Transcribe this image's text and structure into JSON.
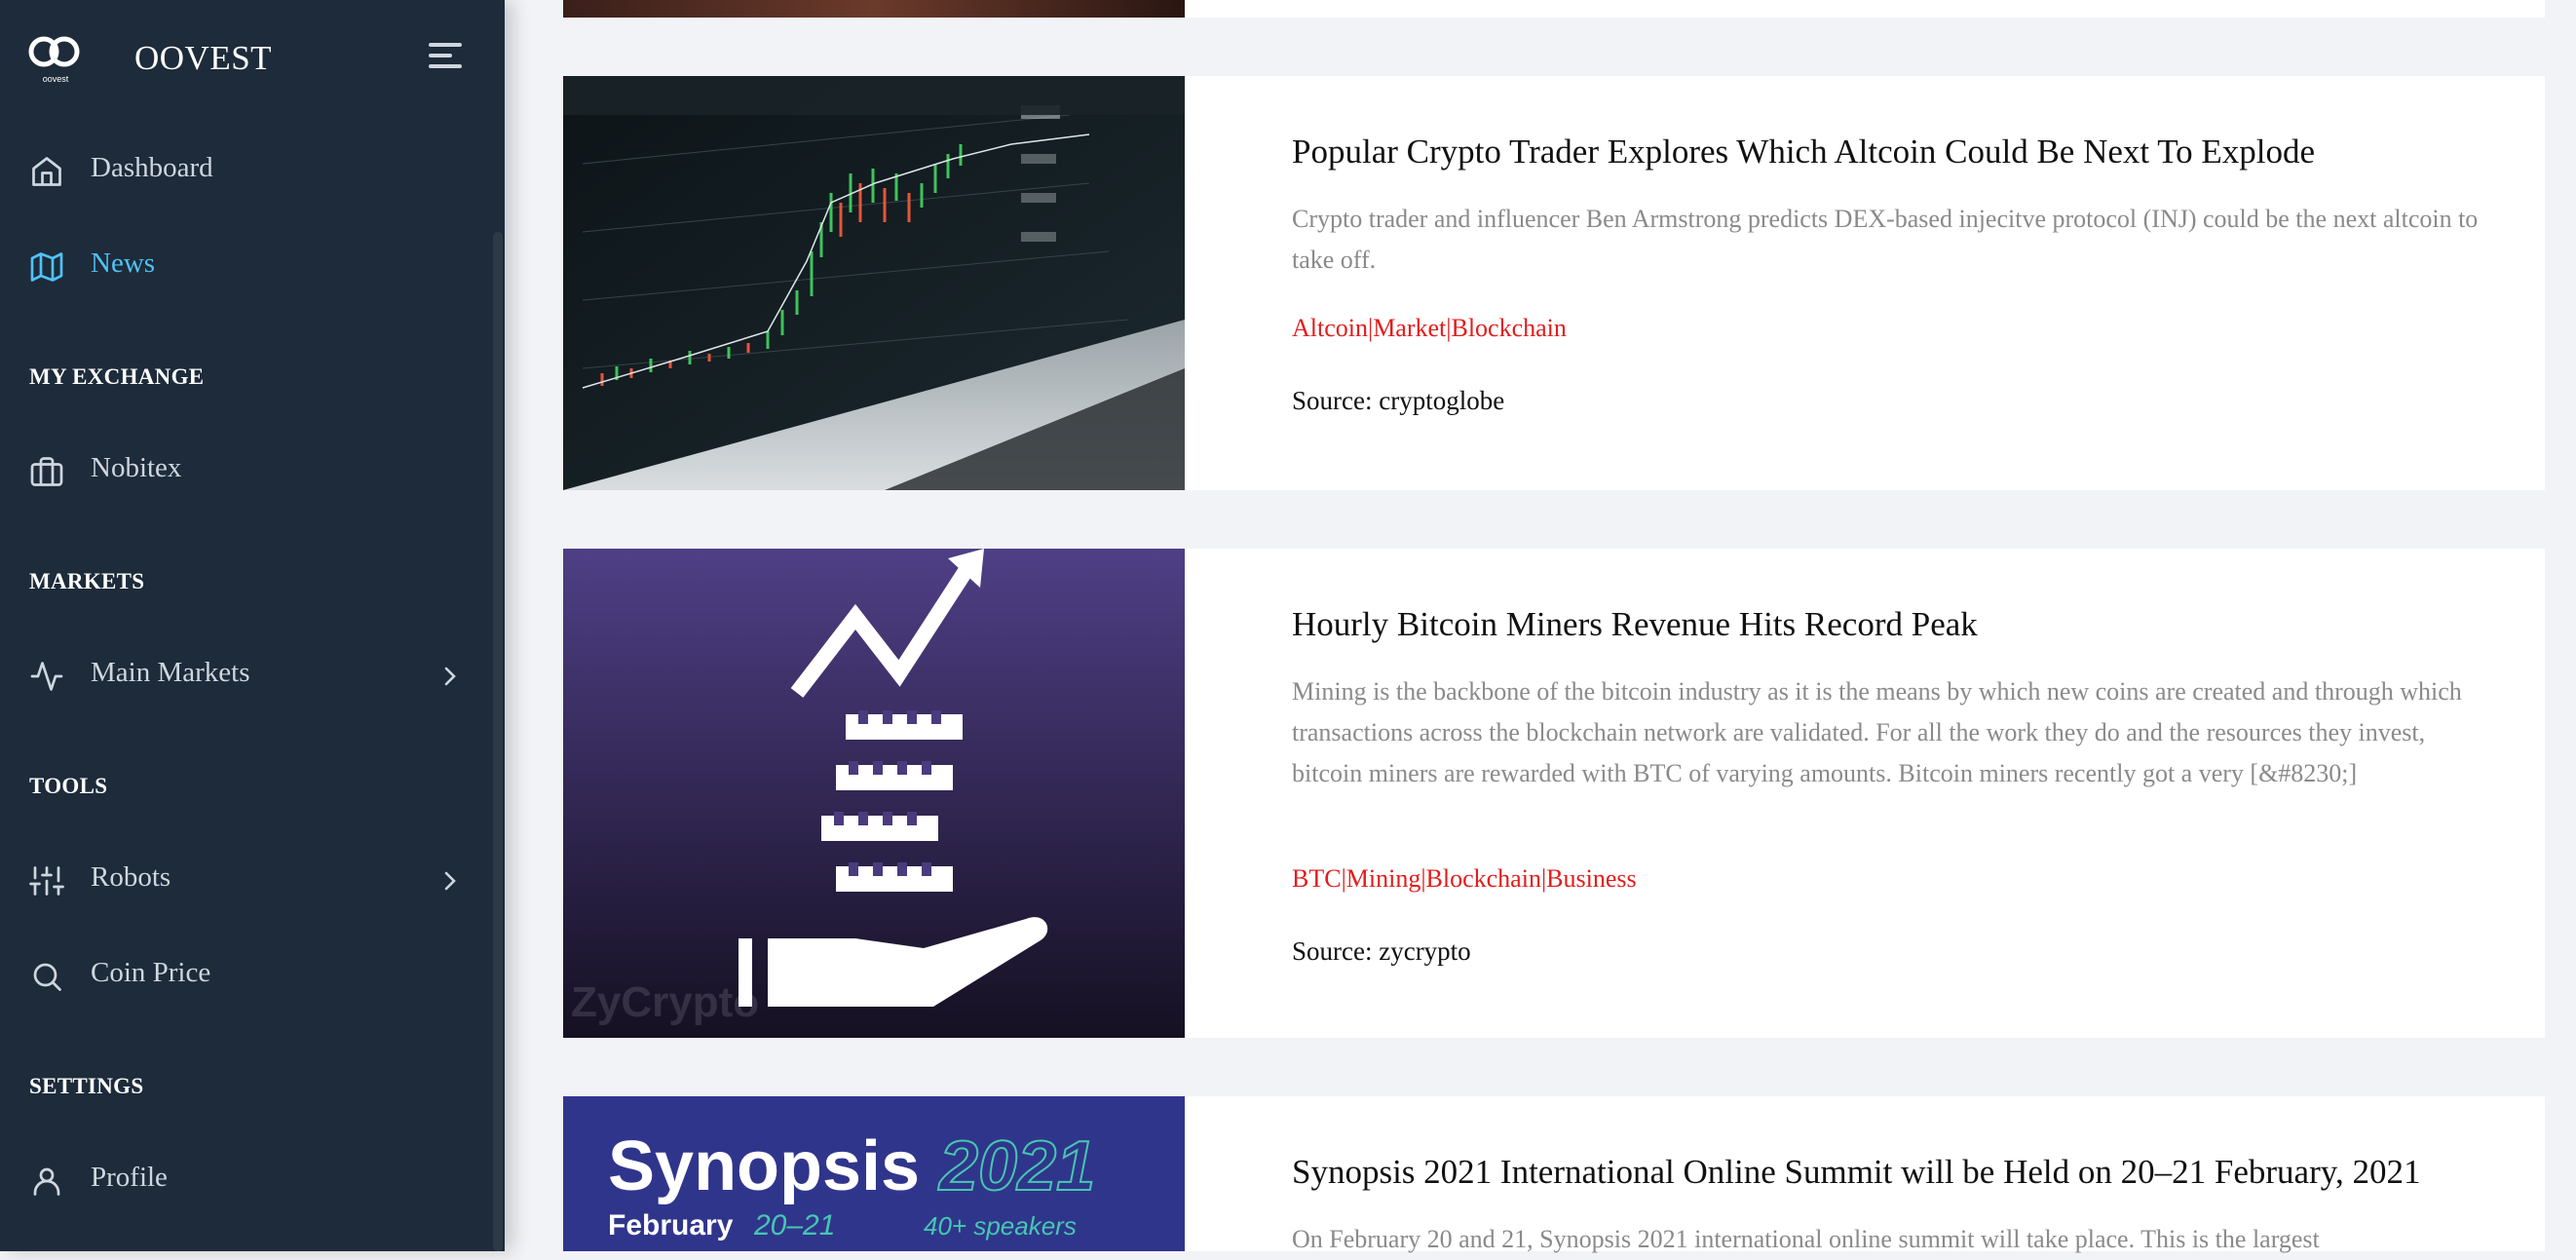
{
  "app": {
    "brand_name": "OOVEST",
    "brand_logo_text": "oovest",
    "accent_color": "#4fc3f7",
    "sidebar_bg": "#1d2b3a",
    "tag_color": "#e31c1c"
  },
  "sidebar": {
    "items": [
      {
        "label": "Dashboard",
        "icon": "home-icon",
        "active": false
      },
      {
        "label": "News",
        "icon": "map-icon",
        "active": true
      },
      {
        "label": "Nobitex",
        "icon": "briefcase-icon",
        "active": false
      },
      {
        "label": "Main Markets",
        "icon": "activity-icon",
        "active": false,
        "has_submenu": true
      },
      {
        "label": "Robots",
        "icon": "sliders-icon",
        "active": false,
        "has_submenu": true
      },
      {
        "label": "Coin Price",
        "icon": "search-icon",
        "active": false
      },
      {
        "label": "Profile",
        "icon": "user-icon",
        "active": false
      }
    ],
    "sections": {
      "my_exchange": "MY EXCHANGE",
      "markets": "MARKETS",
      "tools": "TOOLS",
      "settings": "SETTINGS"
    }
  },
  "news": {
    "articles": [
      {
        "title": "Popular Crypto Trader Explores Which Altcoin Could Be Next To Explode",
        "excerpt": "Crypto trader and influencer Ben Armstrong predicts DEX-based injecitve protocol (INJ) could be the next altcoin to take off.",
        "tags": "Altcoin|Market|Blockchain",
        "source": "Source: cryptoglobe",
        "image": "laptop-trading-chart-image"
      },
      {
        "title": "Hourly Bitcoin Miners Revenue Hits Record Peak",
        "excerpt": "Mining is the backbone of the bitcoin industry as it is the means by which new coins are created and through which transactions across the blockchain network are validated. For all the work they do and the resources they invest, bitcoin miners are rewarded with BTC of varying amounts. Bitcoin miners recently got a very [&#8230;]",
        "tags": "BTC|Mining|Blockchain|Business",
        "source": "Source: zycrypto",
        "image": "zycrypto-hand-coins-image",
        "image_watermark": "ZyCrypto"
      },
      {
        "title": "Synopsis 2021 International Online Summit will be Held on 20–21 February, 2021",
        "excerpt": "On February 20 and 21, Synopsis 2021 international online summit will take place. This is the largest",
        "image": "synopsis-2021-banner-image",
        "image_text": {
          "name": "Synopsis",
          "year": "2021",
          "month": "February",
          "dates": "20–21",
          "speakers": "40+ speakers"
        }
      }
    ]
  }
}
